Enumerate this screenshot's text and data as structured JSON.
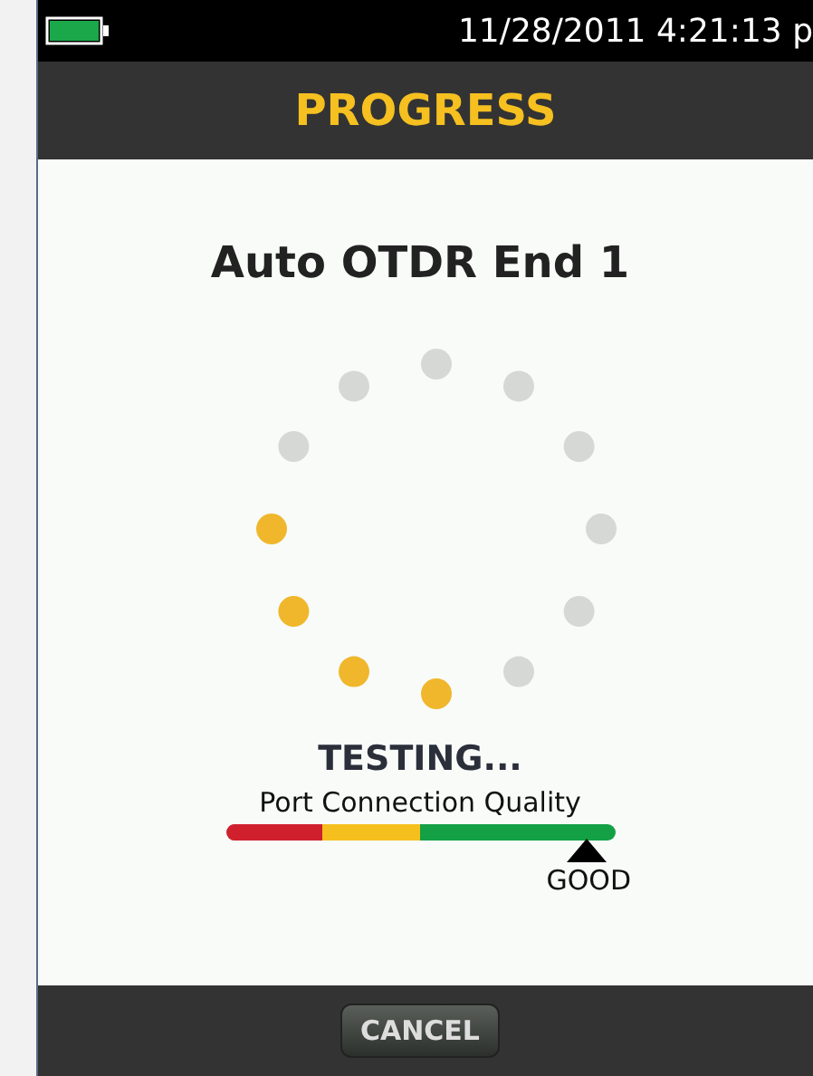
{
  "status_bar": {
    "battery": {
      "level": 1
    },
    "datetime": "11/28/2011 4:21:13 p"
  },
  "header": {
    "title": "PROGRESS"
  },
  "test": {
    "name": "Auto OTDR End 1"
  },
  "spinner": {
    "dots": [
      {
        "on": false
      },
      {
        "on": false
      },
      {
        "on": false
      },
      {
        "on": false
      },
      {
        "on": false
      },
      {
        "on": false
      },
      {
        "on": true
      },
      {
        "on": true
      },
      {
        "on": true
      },
      {
        "on": true
      },
      {
        "on": false
      },
      {
        "on": false
      }
    ]
  },
  "status": "TESTING...",
  "quality": {
    "label": "Port Connection Quality",
    "level": 0.93,
    "reading": "GOOD",
    "segments": [
      {
        "color": "#d0202e"
      },
      {
        "color": "#f5bf1e"
      },
      {
        "color": "#14a045"
      }
    ]
  },
  "buttons": [
    {
      "label": "CANCEL"
    }
  ]
}
